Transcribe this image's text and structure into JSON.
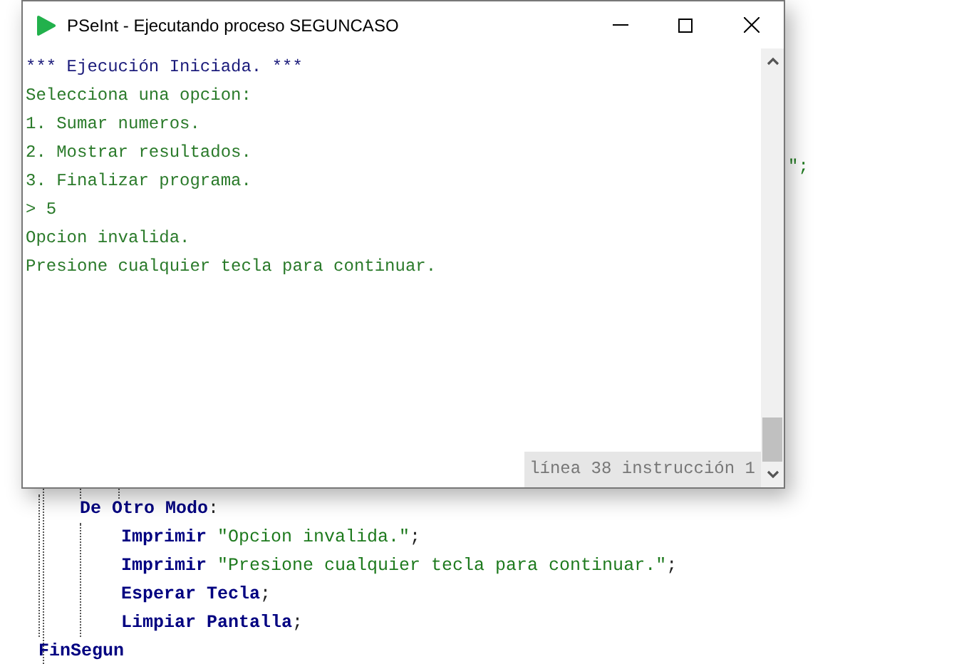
{
  "editor": {
    "fragment": "\";",
    "blocks": [
      {
        "children": [
          {
            "segments": [
              {
                "kind": "keyword",
                "text": "De Otro Modo"
              },
              {
                "kind": "punct",
                "text": ":"
              }
            ],
            "children": [
              {
                "segments": [
                  {
                    "kind": "keyword",
                    "text": "Imprimir"
                  },
                  {
                    "kind": "string",
                    "text": " \"Opcion invalida.\""
                  },
                  {
                    "kind": "punct",
                    "text": ";"
                  }
                ]
              },
              {
                "segments": [
                  {
                    "kind": "keyword",
                    "text": "Imprimir"
                  },
                  {
                    "kind": "string",
                    "text": " \"Presione cualquier tecla para continuar.\""
                  },
                  {
                    "kind": "punct",
                    "text": ";"
                  }
                ]
              },
              {
                "segments": [
                  {
                    "kind": "keyword",
                    "text": "Esperar Tecla"
                  },
                  {
                    "kind": "punct",
                    "text": ";"
                  }
                ]
              },
              {
                "segments": [
                  {
                    "kind": "keyword",
                    "text": "Limpiar Pantalla"
                  },
                  {
                    "kind": "punct",
                    "text": ";"
                  }
                ]
              }
            ]
          }
        ],
        "end": [
          {
            "kind": "keyword",
            "text": "FinSegun"
          }
        ]
      }
    ]
  },
  "window": {
    "title": "PSeInt - Ejecutando proceso SEGUNCASO",
    "console": [
      {
        "kind": "info",
        "text": "*** Ejecución Iniciada. ***"
      },
      {
        "kind": "output",
        "text": "Selecciona una opcion:"
      },
      {
        "kind": "output",
        "text": "1. Sumar numeros."
      },
      {
        "kind": "output",
        "text": "2. Mostrar resultados."
      },
      {
        "kind": "output",
        "text": "3. Finalizar programa."
      },
      {
        "kind": "input",
        "text": "> 5"
      },
      {
        "kind": "output",
        "text": "Opcion invalida."
      },
      {
        "kind": "output",
        "text": "Presione cualquier tecla para continuar."
      }
    ],
    "status": "línea 38 instrucción 1"
  }
}
